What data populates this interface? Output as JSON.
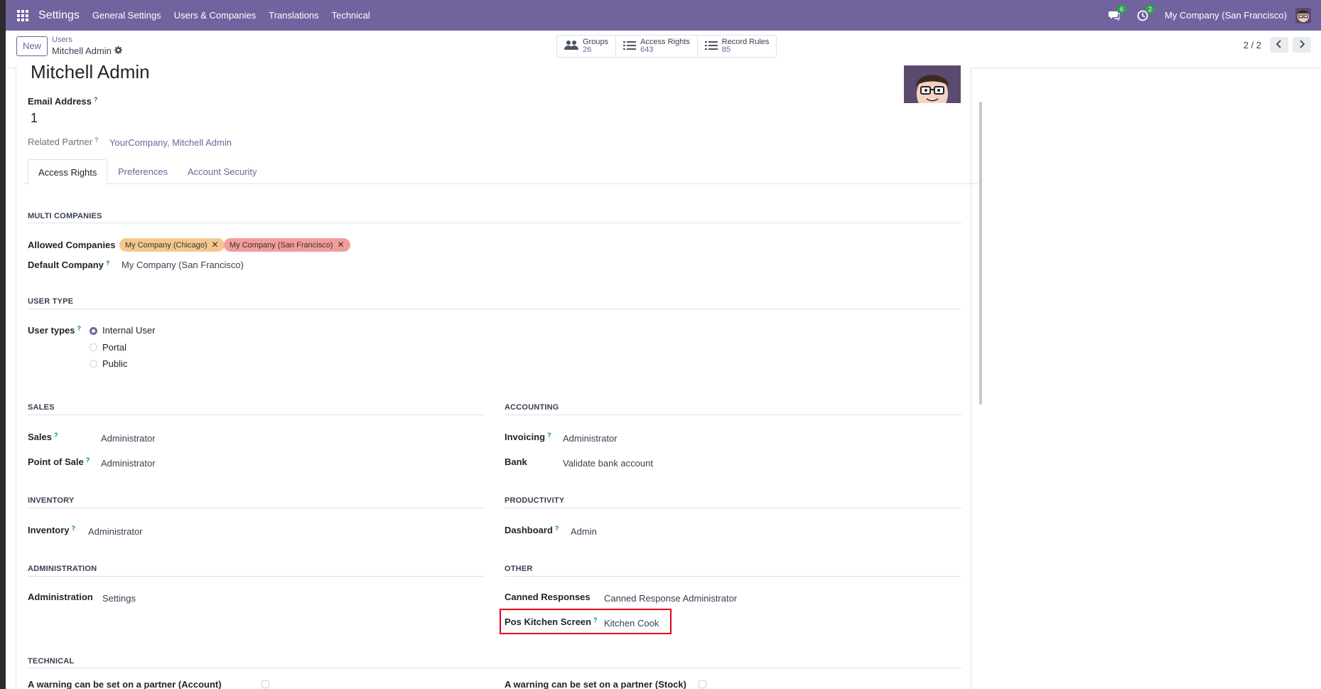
{
  "navbar": {
    "brand": "Settings",
    "menu": [
      "General Settings",
      "Users & Companies",
      "Translations",
      "Technical"
    ],
    "messages_count": "6",
    "activities_count": "2",
    "company": "My Company (San Francisco)",
    "color": "#71639e"
  },
  "control": {
    "new_label": "New",
    "breadcrumb_parent": "Users",
    "breadcrumb_current": "Mitchell Admin",
    "stats": [
      {
        "label": "Groups",
        "value": "26",
        "icon": "users-icon"
      },
      {
        "label": "Access Rights",
        "value": "643",
        "icon": "list-icon"
      },
      {
        "label": "Record Rules",
        "value": "85",
        "icon": "list-icon"
      }
    ],
    "pager": "2 / 2"
  },
  "form": {
    "name": "Mitchell Admin",
    "email_label": "Email Address",
    "email_value": "1",
    "partner_label": "Related Partner",
    "partner_value": "YourCompany, Mitchell Admin",
    "help_mark": "?"
  },
  "tabs": [
    "Access Rights",
    "Preferences",
    "Account Security"
  ],
  "multi_companies": {
    "title": "MULTI COMPANIES",
    "allowed_label": "Allowed Companies",
    "allowed": [
      {
        "name": "My Company (Chicago)",
        "color": "#f4c78e"
      },
      {
        "name": "My Company (San Francisco)",
        "color": "#f29c9c"
      }
    ],
    "default_label": "Default Company",
    "default_value": "My Company (San Francisco)"
  },
  "user_type": {
    "title": "USER TYPE",
    "label": "User types",
    "options": [
      "Internal User",
      "Portal",
      "Public"
    ],
    "selected": "Internal User"
  },
  "sales": {
    "title": "SALES",
    "rows": [
      {
        "label": "Sales",
        "value": "Administrator"
      },
      {
        "label": "Point of Sale",
        "value": "Administrator"
      }
    ]
  },
  "accounting": {
    "title": "ACCOUNTING",
    "rows": [
      {
        "label": "Invoicing",
        "value": "Administrator"
      },
      {
        "label": "Bank",
        "value": "Validate bank account"
      }
    ]
  },
  "inventory": {
    "title": "INVENTORY",
    "rows": [
      {
        "label": "Inventory",
        "value": "Administrator"
      }
    ]
  },
  "productivity": {
    "title": "PRODUCTIVITY",
    "rows": [
      {
        "label": "Dashboard",
        "value": "Admin"
      }
    ]
  },
  "administration": {
    "title": "ADMINISTRATION",
    "rows": [
      {
        "label": "Administration",
        "value": "Settings"
      }
    ]
  },
  "other": {
    "title": "OTHER",
    "rows": [
      {
        "label": "Canned Responses",
        "value": "Canned Response Administrator"
      },
      {
        "label": "Pos Kitchen Screen",
        "value": "Kitchen Cook"
      }
    ]
  },
  "technical": {
    "title": "TECHNICAL",
    "rows": [
      {
        "label": "A warning can be set on a partner (Account)"
      },
      {
        "label": "A warning can be set on a partner (Stock)"
      }
    ]
  }
}
